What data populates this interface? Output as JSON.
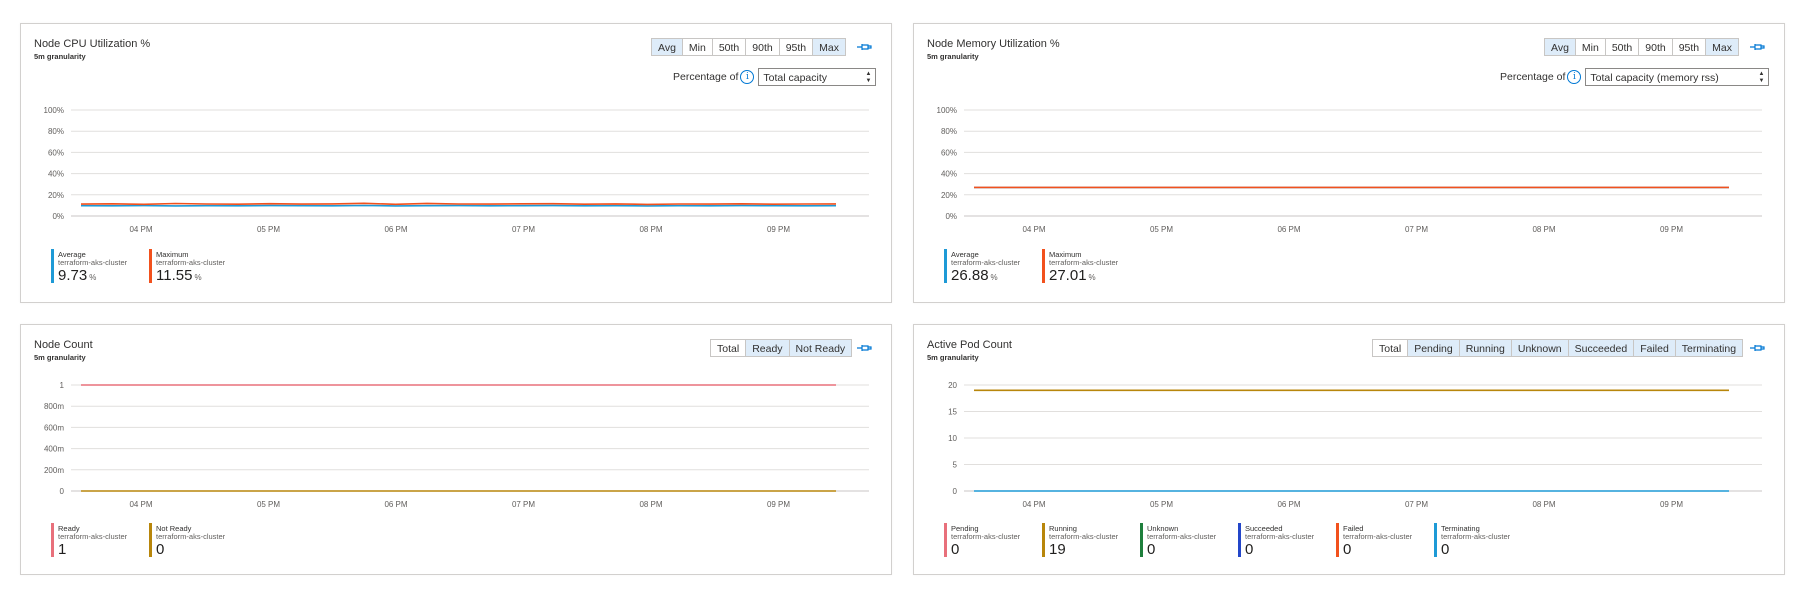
{
  "panels": [
    {
      "id": "cpu",
      "title": "Node CPU Utilization %",
      "subtitle": "5m granularity",
      "segments": [
        {
          "label": "Avg",
          "active": true
        },
        {
          "label": "Min",
          "active": false
        },
        {
          "label": "50th",
          "active": false
        },
        {
          "label": "90th",
          "active": false
        },
        {
          "label": "95th",
          "active": false
        },
        {
          "label": "Max",
          "active": true
        }
      ],
      "percentage_of": {
        "label": "Percentage of",
        "value": "Total capacity"
      },
      "legend": [
        {
          "name": "Average",
          "sub": "terraform-aks-cluster",
          "value": "9.73",
          "unit": "%",
          "color": "#1e9ad6"
        },
        {
          "name": "Maximum",
          "sub": "terraform-aks-cluster",
          "value": "11.55",
          "unit": "%",
          "color": "#f2511d"
        }
      ]
    },
    {
      "id": "mem",
      "title": "Node Memory Utilization %",
      "subtitle": "5m granularity",
      "segments": [
        {
          "label": "Avg",
          "active": true
        },
        {
          "label": "Min",
          "active": false
        },
        {
          "label": "50th",
          "active": false
        },
        {
          "label": "90th",
          "active": false
        },
        {
          "label": "95th",
          "active": false
        },
        {
          "label": "Max",
          "active": true
        }
      ],
      "percentage_of": {
        "label": "Percentage of",
        "value": "Total capacity (memory rss)"
      },
      "legend": [
        {
          "name": "Average",
          "sub": "terraform-aks-cluster",
          "value": "26.88",
          "unit": "%",
          "color": "#1e9ad6"
        },
        {
          "name": "Maximum",
          "sub": "terraform-aks-cluster",
          "value": "27.01",
          "unit": "%",
          "color": "#f2511d"
        }
      ]
    },
    {
      "id": "node",
      "title": "Node Count",
      "subtitle": "5m granularity",
      "segments": [
        {
          "label": "Total",
          "active": false
        },
        {
          "label": "Ready",
          "active": true
        },
        {
          "label": "Not Ready",
          "active": true
        }
      ],
      "legend": [
        {
          "name": "Ready",
          "sub": "terraform-aks-cluster",
          "value": "1",
          "unit": "",
          "color": "#e8707b"
        },
        {
          "name": "Not Ready",
          "sub": "terraform-aks-cluster",
          "value": "0",
          "unit": "",
          "color": "#b8860b"
        }
      ]
    },
    {
      "id": "pod",
      "title": "Active Pod Count",
      "subtitle": "5m granularity",
      "segments": [
        {
          "label": "Total",
          "active": false
        },
        {
          "label": "Pending",
          "active": true
        },
        {
          "label": "Running",
          "active": true
        },
        {
          "label": "Unknown",
          "active": true
        },
        {
          "label": "Succeeded",
          "active": true
        },
        {
          "label": "Failed",
          "active": true
        },
        {
          "label": "Terminating",
          "active": true
        }
      ],
      "legend": [
        {
          "name": "Pending",
          "sub": "terraform-aks-cluster",
          "value": "0",
          "unit": "",
          "color": "#e8707b"
        },
        {
          "name": "Running",
          "sub": "terraform-aks-cluster",
          "value": "19",
          "unit": "",
          "color": "#b8860b"
        },
        {
          "name": "Unknown",
          "sub": "terraform-aks-cluster",
          "value": "0",
          "unit": "",
          "color": "#1e7f3c"
        },
        {
          "name": "Succeeded",
          "sub": "terraform-aks-cluster",
          "value": "0",
          "unit": "",
          "color": "#2346c9"
        },
        {
          "name": "Failed",
          "sub": "terraform-aks-cluster",
          "value": "0",
          "unit": "",
          "color": "#f2511d"
        },
        {
          "name": "Terminating",
          "sub": "terraform-aks-cluster",
          "value": "0",
          "unit": "",
          "color": "#1e9ad6"
        }
      ]
    }
  ],
  "chart_data": [
    {
      "type": "line",
      "x": [
        "04 PM",
        "05 PM",
        "06 PM",
        "07 PM",
        "08 PM",
        "09 PM"
      ],
      "yticks": [
        "0%",
        "20%",
        "40%",
        "60%",
        "80%",
        "100%"
      ],
      "ylim": [
        0,
        100
      ],
      "series": [
        {
          "name": "Average",
          "color": "#1e9ad6",
          "values": [
            9.7,
            9.6,
            9.8,
            9.5,
            9.7,
            9.6,
            9.8,
            9.7,
            9.6,
            9.9,
            9.5,
            9.7,
            9.8,
            9.6,
            9.7,
            9.8,
            9.6,
            9.7,
            9.5,
            9.7,
            9.6,
            9.8,
            9.7,
            9.6,
            9.7
          ]
        },
        {
          "name": "Maximum",
          "color": "#f2511d",
          "values": [
            11.2,
            11.5,
            11.0,
            11.8,
            11.3,
            11.1,
            11.6,
            11.2,
            11.4,
            12.0,
            11.0,
            11.9,
            11.3,
            11.2,
            11.5,
            11.6,
            11.1,
            11.4,
            10.9,
            11.3,
            11.2,
            11.5,
            11.1,
            11.3,
            11.4
          ]
        }
      ]
    },
    {
      "type": "line",
      "x": [
        "04 PM",
        "05 PM",
        "06 PM",
        "07 PM",
        "08 PM",
        "09 PM"
      ],
      "yticks": [
        "0%",
        "20%",
        "40%",
        "60%",
        "80%",
        "100%"
      ],
      "ylim": [
        0,
        100
      ],
      "series": [
        {
          "name": "Average",
          "color": "#1e9ad6",
          "values": [
            26.9,
            26.9,
            26.9,
            26.9,
            26.9,
            26.9,
            26.9,
            26.9,
            26.9,
            26.9,
            26.9,
            26.9,
            26.9,
            26.9,
            26.9,
            26.9,
            26.9,
            26.9,
            26.9,
            26.9,
            26.9,
            26.9,
            26.9,
            26.9,
            26.9
          ]
        },
        {
          "name": "Maximum",
          "color": "#f2511d",
          "values": [
            27.0,
            27.0,
            27.0,
            27.0,
            27.0,
            27.0,
            27.0,
            27.0,
            27.0,
            27.0,
            27.0,
            27.0,
            27.0,
            27.0,
            27.0,
            27.0,
            27.0,
            27.0,
            27.0,
            27.0,
            27.0,
            27.0,
            27.0,
            27.0,
            27.0
          ]
        }
      ]
    },
    {
      "type": "line",
      "x": [
        "04 PM",
        "05 PM",
        "06 PM",
        "07 PM",
        "08 PM",
        "09 PM"
      ],
      "yticks": [
        "0",
        "200m",
        "400m",
        "600m",
        "800m",
        "1"
      ],
      "ylim": [
        0,
        1
      ],
      "series": [
        {
          "name": "Ready",
          "color": "#e8707b",
          "values": [
            1,
            1,
            1,
            1,
            1,
            1,
            1,
            1,
            1,
            1,
            1,
            1,
            1,
            1,
            1,
            1,
            1,
            1,
            1,
            1,
            1,
            1,
            1,
            1,
            1
          ]
        },
        {
          "name": "Not Ready",
          "color": "#b8860b",
          "values": [
            0,
            0,
            0,
            0,
            0,
            0,
            0,
            0,
            0,
            0,
            0,
            0,
            0,
            0,
            0,
            0,
            0,
            0,
            0,
            0,
            0,
            0,
            0,
            0,
            0
          ]
        }
      ]
    },
    {
      "type": "line",
      "x": [
        "04 PM",
        "05 PM",
        "06 PM",
        "07 PM",
        "08 PM",
        "09 PM"
      ],
      "yticks": [
        "0",
        "5",
        "10",
        "15",
        "20"
      ],
      "ylim": [
        0,
        20
      ],
      "series": [
        {
          "name": "Running",
          "color": "#b8860b",
          "values": [
            19,
            19,
            19,
            19,
            19,
            19,
            19,
            19,
            19,
            19,
            19,
            19,
            19,
            19,
            19,
            19,
            19,
            19,
            19,
            19,
            19,
            19,
            19,
            19,
            19
          ]
        },
        {
          "name": "Terminating",
          "color": "#1e9ad6",
          "values": [
            0,
            0,
            0,
            0,
            0,
            0,
            0,
            0,
            0,
            0,
            0,
            0,
            0,
            0,
            0,
            0,
            0,
            0,
            0,
            0,
            0,
            0,
            0,
            0,
            0
          ]
        }
      ]
    }
  ]
}
